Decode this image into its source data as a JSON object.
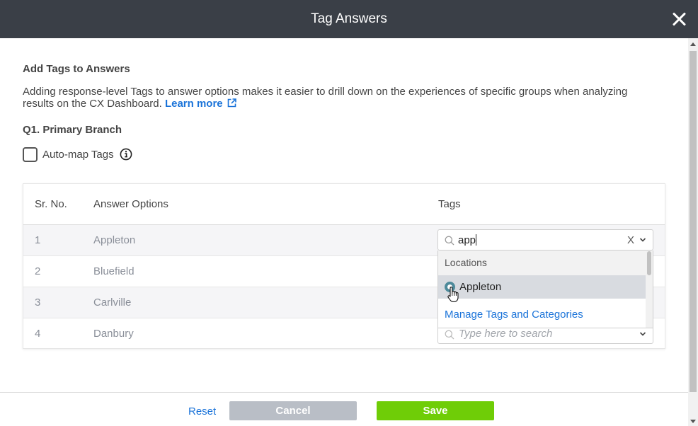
{
  "header": {
    "title": "Tag Answers"
  },
  "content": {
    "section_title": "Add Tags to Answers",
    "description": "Adding response-level Tags to answer options makes it easier to drill down on the experiences of specific groups when analyzing results on the CX Dashboard.",
    "learn_more": "Learn more",
    "question_title": "Q1. Primary Branch",
    "automap_label": "Auto-map Tags"
  },
  "table": {
    "headers": {
      "sr_no": "Sr. No.",
      "answer_options": "Answer Options",
      "tags": "Tags"
    },
    "rows": [
      {
        "sr": "1",
        "answer": "Appleton"
      },
      {
        "sr": "2",
        "answer": "Bluefield"
      },
      {
        "sr": "3",
        "answer": "Carlville"
      },
      {
        "sr": "4",
        "answer": "Danbury"
      }
    ]
  },
  "tag_select": {
    "value": "app",
    "clear": "X",
    "placeholder": "Type here to search"
  },
  "dropdown": {
    "group": "Locations",
    "items": [
      {
        "label": "Appleton",
        "selected": true
      }
    ],
    "manage_link": "Manage Tags and Categories"
  },
  "footer": {
    "reset": "Reset",
    "cancel": "Cancel",
    "save": "Save"
  },
  "colors": {
    "header_bg": "#3a3f47",
    "link": "#1a73d9",
    "save": "#6fcd07",
    "cancel": "#b9bec6"
  },
  "icons": [
    "close-icon",
    "external-link-icon",
    "info-icon",
    "search-icon",
    "chevron-down-icon",
    "hand-cursor-icon"
  ]
}
